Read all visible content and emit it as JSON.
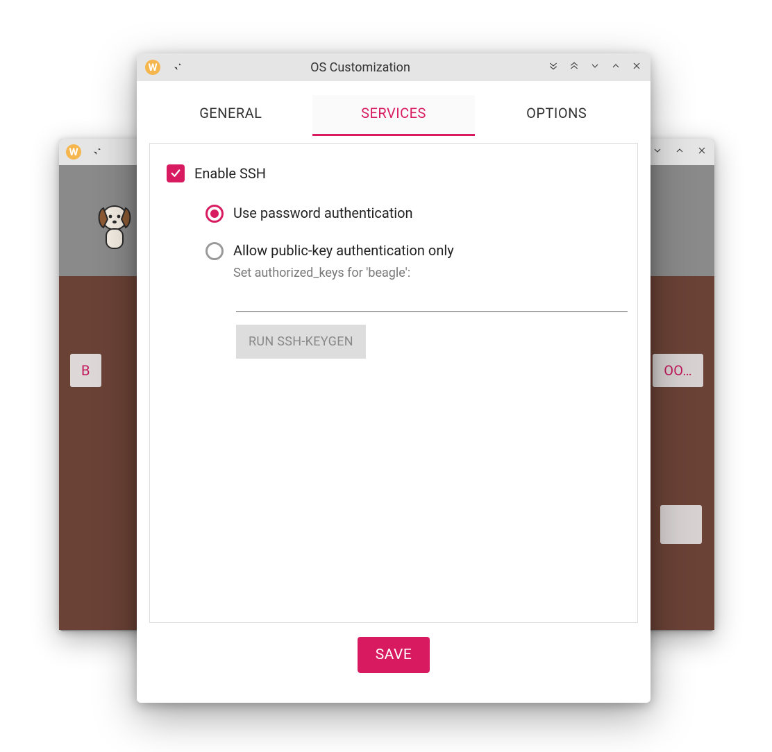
{
  "colors": {
    "accent": "#d81b60",
    "titlebar": "#e5e5e5",
    "back_lower": "#6b4236"
  },
  "back_window": {
    "app_badge": "W",
    "left_button_text": "B",
    "right_button_text": "OO…"
  },
  "front_window": {
    "app_badge": "W",
    "title": "OS Customization",
    "tabs": [
      {
        "id": "general",
        "label": "GENERAL",
        "active": false
      },
      {
        "id": "services",
        "label": "SERVICES",
        "active": true
      },
      {
        "id": "options",
        "label": "OPTIONS",
        "active": false
      }
    ],
    "services": {
      "enable_ssh": {
        "label": "Enable SSH",
        "checked": true
      },
      "auth_mode": {
        "selected": "password",
        "options": [
          {
            "id": "password",
            "label": "Use password authentication"
          },
          {
            "id": "pubkey",
            "label": "Allow public-key authentication only"
          }
        ]
      },
      "authorized_keys_hint": "Set authorized_keys for 'beagle':",
      "authorized_keys_value": "",
      "keygen_button": "RUN SSH-KEYGEN"
    },
    "save_button": "SAVE"
  }
}
